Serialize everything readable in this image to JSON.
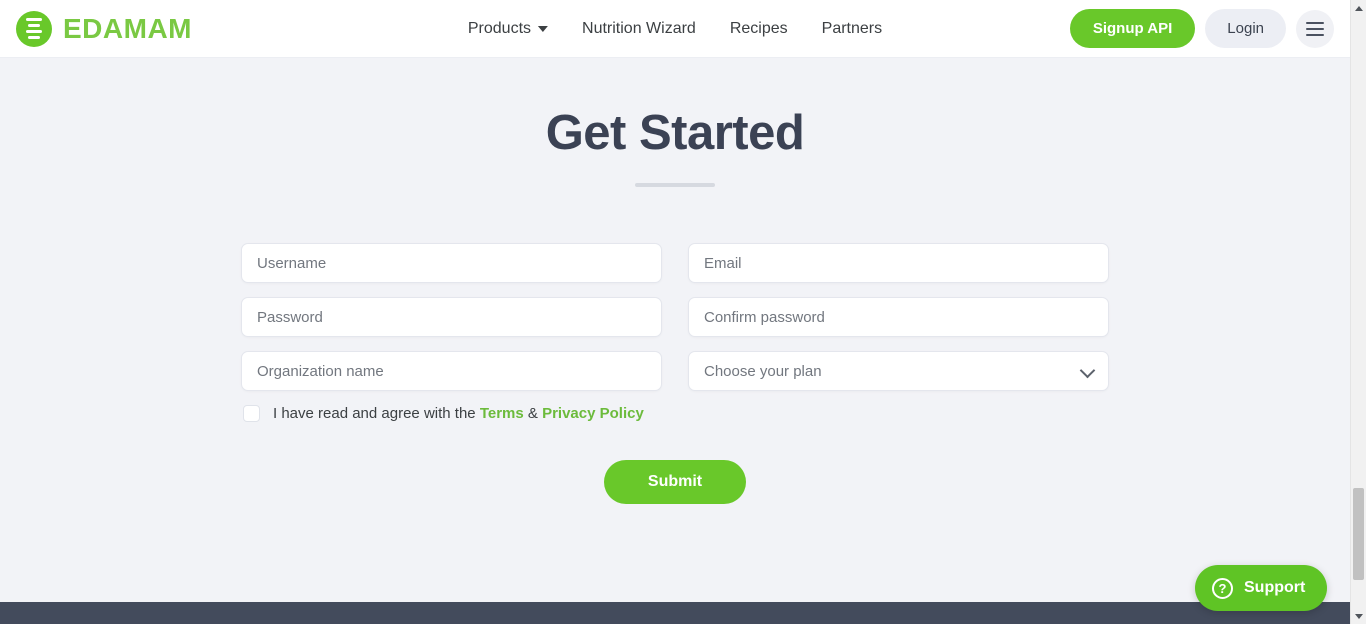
{
  "header": {
    "brand": {
      "name": "EDAMAM",
      "mark_icon": "list-lines-icon"
    },
    "nav": [
      {
        "label": "Products",
        "has_dropdown": true
      },
      {
        "label": "Nutrition Wizard",
        "has_dropdown": false
      },
      {
        "label": "Recipes",
        "has_dropdown": false
      },
      {
        "label": "Partners",
        "has_dropdown": false
      }
    ],
    "signup_label": "Signup API",
    "login_label": "Login",
    "menu_icon": "hamburger-menu-icon"
  },
  "main": {
    "title": "Get Started",
    "form": {
      "username_placeholder": "Username",
      "email_placeholder": "Email",
      "password_placeholder": "Password",
      "confirm_password_placeholder": "Confirm password",
      "organization_placeholder": "Organization name",
      "plan_selected": "Choose your plan",
      "plan_chevron_icon": "chevron-down-icon",
      "terms_prefix": "I have read and agree with the ",
      "terms_link": "Terms",
      "terms_separator": " & ",
      "privacy_link": "Privacy Policy",
      "submit_label": "Submit"
    }
  },
  "support": {
    "label": "Support",
    "icon": "question-mark-circle-icon"
  },
  "colors": {
    "brand_green": "#7ac943",
    "button_green": "#69c82a",
    "link_green": "#6cbb3c",
    "title_navy": "#3b4254",
    "footer_slate": "#434b5c",
    "page_background": "#f2f3f7"
  }
}
